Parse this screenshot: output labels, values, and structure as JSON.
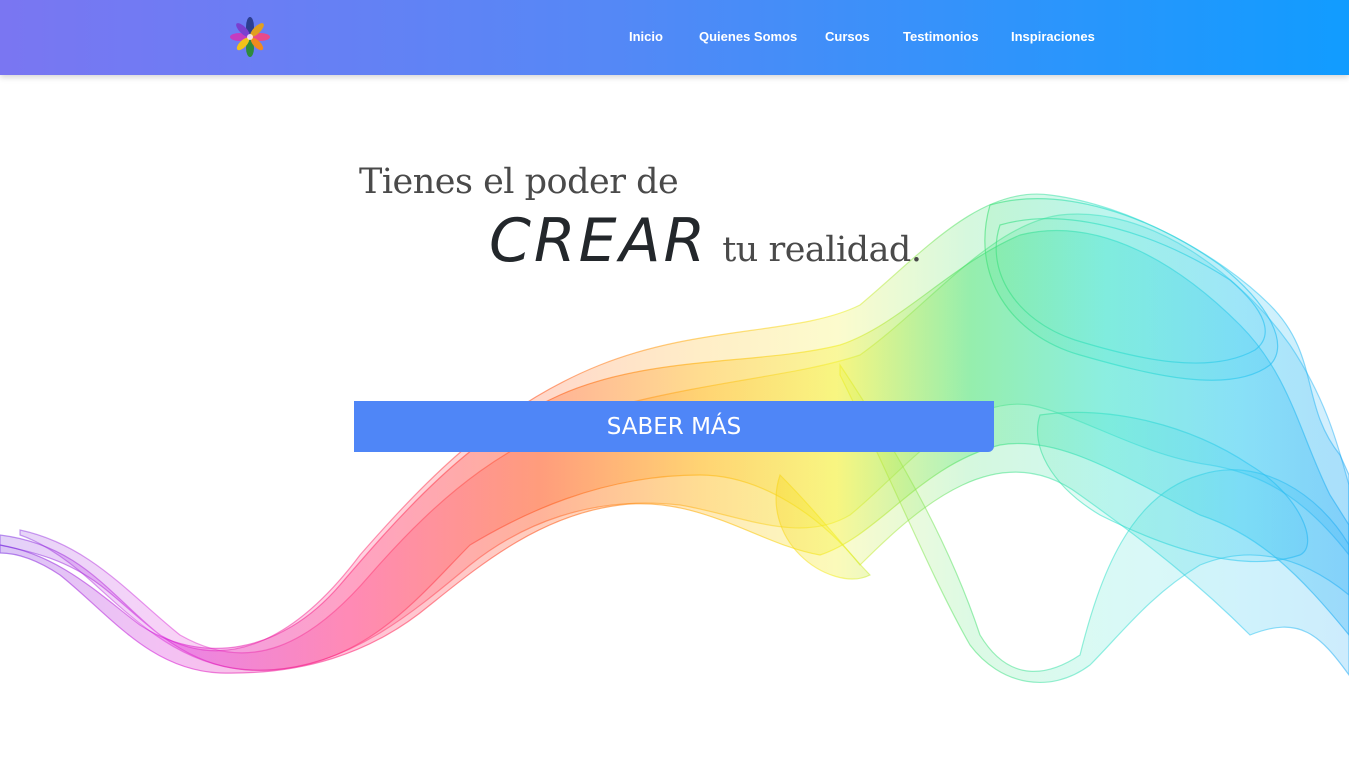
{
  "nav": {
    "items": [
      {
        "label": "Inicio"
      },
      {
        "label": "Quienes Somos"
      },
      {
        "label": "Cursos"
      },
      {
        "label": "Testimonios"
      },
      {
        "label": "Inspiraciones"
      }
    ],
    "logo_icon": "lotus-flower-icon",
    "gradient": [
      "#7a76f2",
      "#119cff"
    ]
  },
  "hero": {
    "line1": "Tienes el poder de",
    "highlight": "CREAR",
    "line2": "tu realidad.",
    "cta_label": "SABER MÁS",
    "cta_color": "#4f86f7",
    "decoration_icon": "rainbow-smoke-ribbon"
  }
}
